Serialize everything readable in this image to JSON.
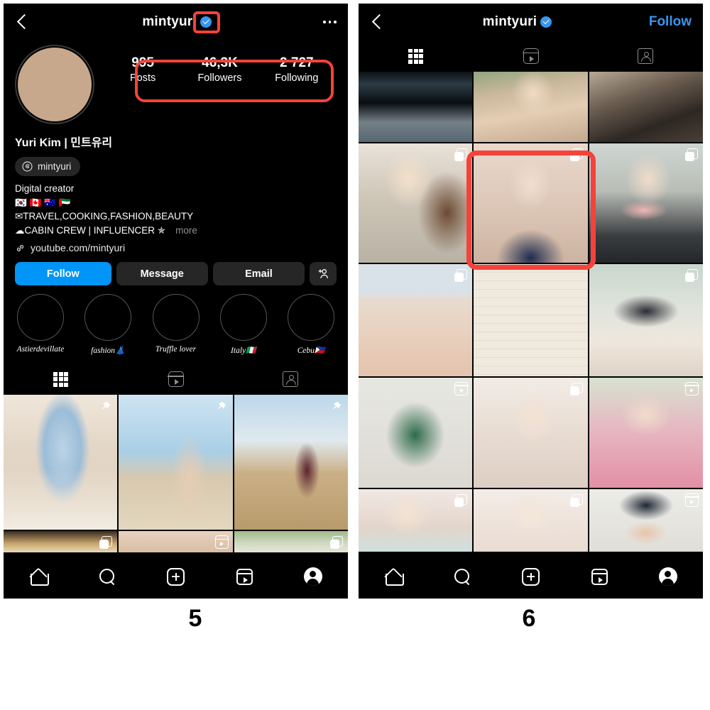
{
  "figure": {
    "slide_labels": [
      "5",
      "6"
    ]
  },
  "left_panel": {
    "header": {
      "back_icon": "back-chevron-icon",
      "username": "mintyuri",
      "verified_icon": "verified-badge-icon",
      "menu_icon": "more-options-icon"
    },
    "profile": {
      "avatar_name": "profile-avatar",
      "full_name": "Yuri Kim | 민트유리",
      "stats": [
        {
          "number": "995",
          "label": "Posts"
        },
        {
          "number": "46,3K",
          "label": "Followers"
        },
        {
          "number": "2 727",
          "label": "Following"
        }
      ],
      "threads_chip": {
        "icon": "threads-icon",
        "label": "mintyuri"
      },
      "bio": {
        "category": "Digital creator",
        "flags_line": "🇰🇷 🇨🇦 🇦🇺 🇦🇪",
        "line2": "✉TRAVEL,COOKING,FASHION,BEAUTY",
        "line3": "☁CABIN CREW | INFLUENCER ✯",
        "more_label": "more"
      },
      "link": {
        "icon": "link-icon",
        "text": "youtube.com/mintyuri"
      }
    },
    "actions": [
      {
        "label": "Follow",
        "style": "primary",
        "name": "follow-button"
      },
      {
        "label": "Message",
        "style": "secondary",
        "name": "message-button"
      },
      {
        "label": "Email",
        "style": "secondary",
        "name": "email-button"
      }
    ],
    "action_icon_button": {
      "icon": "add-person-icon",
      "name": "add-person-button"
    },
    "highlights": [
      {
        "label": "Astierdevillate"
      },
      {
        "label": "fashion👗"
      },
      {
        "label": "Truffle lover"
      },
      {
        "label": "Italy🇮🇹"
      },
      {
        "label": "Cebu🇵🇭"
      }
    ],
    "tabs": [
      {
        "icon": "grid-icon",
        "name": "tab-posts",
        "active": true
      },
      {
        "icon": "reels-icon",
        "name": "tab-reels",
        "active": false
      },
      {
        "icon": "tagged-icon",
        "name": "tab-tagged",
        "active": false
      }
    ],
    "grid": {
      "row1": [
        {
          "badge": "pin",
          "theme": "paris-window"
        },
        {
          "badge": "pin",
          "theme": "beach-dubai"
        },
        {
          "badge": "pin",
          "theme": "desert-flag"
        }
      ],
      "row2": [
        {
          "badge": "carousel",
          "theme": "interior-gold"
        },
        {
          "badge": "reel",
          "theme": "indoor-warm"
        },
        {
          "badge": "carousel",
          "theme": "garden-green"
        }
      ]
    },
    "bottom_nav": [
      {
        "icon": "home-icon",
        "name": "nav-home"
      },
      {
        "icon": "search-icon",
        "name": "nav-search"
      },
      {
        "icon": "create-icon",
        "name": "nav-create"
      },
      {
        "icon": "reels-icon",
        "name": "nav-reels"
      },
      {
        "icon": "profile-icon",
        "name": "nav-profile"
      }
    ]
  },
  "right_panel": {
    "header": {
      "back_icon": "back-chevron-icon",
      "username": "mintyuri",
      "verified_icon": "verified-badge-icon",
      "follow_label": "Follow"
    },
    "tabs": [
      {
        "icon": "grid-icon",
        "name": "tab-posts",
        "active": true
      },
      {
        "icon": "reels-icon",
        "name": "tab-reels",
        "active": false
      },
      {
        "icon": "tagged-icon",
        "name": "tab-tagged",
        "active": false
      }
    ],
    "grid_rows": [
      [
        {
          "badge": "none",
          "theme": "dark-window"
        },
        {
          "badge": "none",
          "theme": "selfie-outdoor"
        },
        {
          "badge": "none",
          "theme": "bag-tweed"
        }
      ],
      [
        {
          "badge": "carousel",
          "theme": "selfie-silver"
        },
        {
          "badge": "carousel",
          "theme": "sunglasses-navy",
          "highlighted": true
        },
        {
          "badge": "carousel",
          "theme": "mask-pink"
        }
      ],
      [
        {
          "badge": "carousel",
          "theme": "vote-hand"
        },
        {
          "badge": "none",
          "theme": "handwritten-note"
        },
        {
          "badge": "carousel",
          "theme": "group-friends"
        }
      ],
      [
        {
          "badge": "reel",
          "theme": "green-top"
        },
        {
          "badge": "carousel",
          "theme": "headband-white"
        },
        {
          "badge": "reel",
          "theme": "sunglasses-pink"
        }
      ],
      [
        {
          "badge": "carousel",
          "theme": "selfie-bright"
        },
        {
          "badge": "carousel",
          "theme": "selfie-soft"
        },
        {
          "badge": "reel",
          "theme": "cap-glasses"
        }
      ]
    ],
    "bottom_nav": [
      {
        "icon": "home-icon",
        "name": "nav-home"
      },
      {
        "icon": "search-icon",
        "name": "nav-search"
      },
      {
        "icon": "create-icon",
        "name": "nav-create"
      },
      {
        "icon": "reels-icon",
        "name": "nav-reels"
      },
      {
        "icon": "profile-icon",
        "name": "nav-profile"
      }
    ]
  },
  "annotations": {
    "color": "#f4433a",
    "items": [
      {
        "name": "verified-badge-highlight"
      },
      {
        "name": "stats-row-highlight"
      },
      {
        "name": "selected-post-highlight"
      }
    ]
  }
}
